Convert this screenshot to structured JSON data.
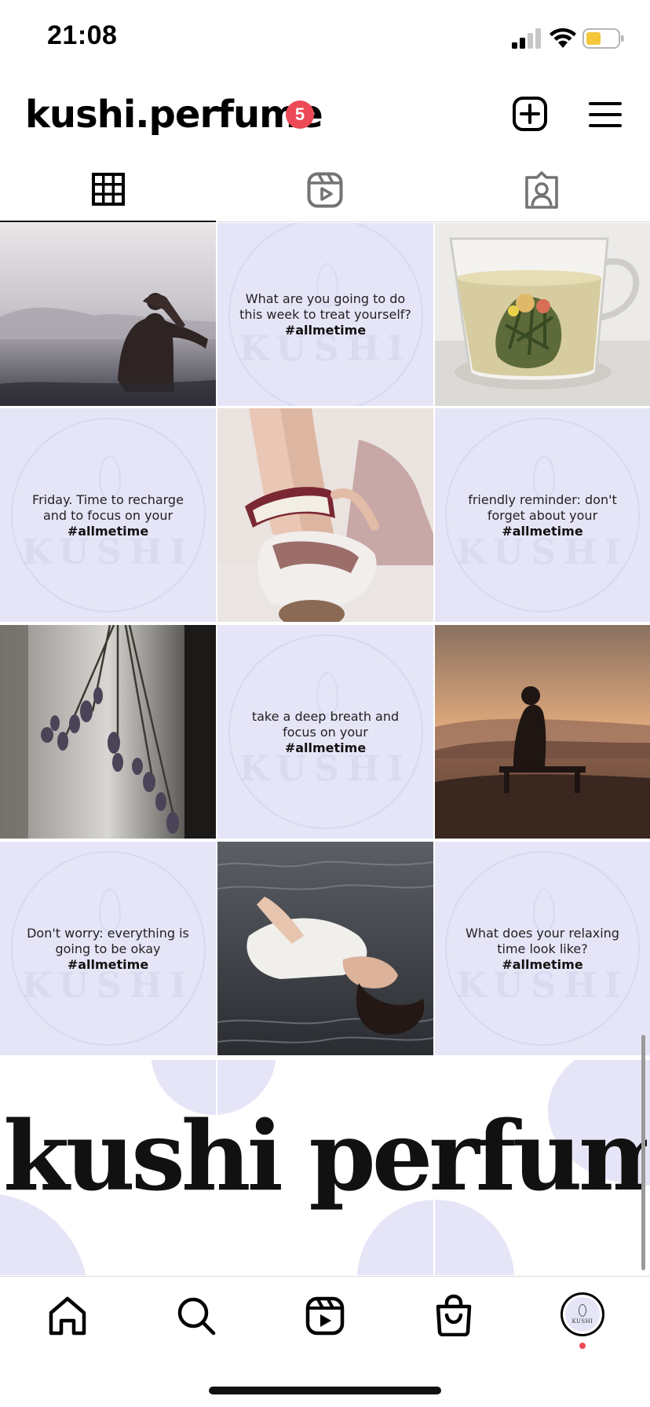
{
  "status_bar": {
    "time": "21:08"
  },
  "header": {
    "username": "kushi.perfume",
    "notification_count": "5",
    "badge_color": "#ed4956"
  },
  "tabs": [
    {
      "name": "posts-grid",
      "icon": "grid-icon",
      "active": true
    },
    {
      "name": "reels",
      "icon": "reels-icon",
      "active": false
    },
    {
      "name": "tagged",
      "icon": "tagged-icon",
      "active": false
    }
  ],
  "theme": {
    "lavender": "#e5e5f7",
    "lavender_circle": "#dadcf4"
  },
  "posts": [
    {
      "kind": "photo",
      "subject": "woman in lake"
    },
    {
      "kind": "quote",
      "text": "What are you going to do this week to treat yourself?",
      "hashtag": "#allmetime",
      "watermark": "KUSHI"
    },
    {
      "kind": "photo",
      "subject": "flowering tea in glass cup"
    },
    {
      "kind": "quote",
      "text": "Friday. Time to recharge and to focus on your",
      "hashtag": "#allmetime",
      "watermark": "KUSHI"
    },
    {
      "kind": "photo",
      "subject": "woman reading book on bed"
    },
    {
      "kind": "quote",
      "text": "friendly reminder: don't forget about your",
      "hashtag": "#allmetime",
      "watermark": "KUSHI"
    },
    {
      "kind": "photo",
      "subject": "hanging dried lavender"
    },
    {
      "kind": "quote",
      "text": "take a deep breath and focus on your",
      "hashtag": "#allmetime",
      "watermark": "KUSHI"
    },
    {
      "kind": "photo",
      "subject": "woman on bench at sunset"
    },
    {
      "kind": "quote",
      "text": "Don't worry: everything is going to be okay",
      "hashtag": "#allmetime",
      "watermark": "KUSHI"
    },
    {
      "kind": "photo",
      "subject": "woman lying in water"
    },
    {
      "kind": "quote",
      "text": "What does your relaxing time look like?",
      "hashtag": "#allmetime",
      "watermark": "KUSHI"
    }
  ],
  "banner": {
    "text": "kushi perfume"
  },
  "bottom_nav": [
    {
      "name": "home",
      "icon": "home-icon"
    },
    {
      "name": "search",
      "icon": "search-icon"
    },
    {
      "name": "reels",
      "icon": "reels-icon"
    },
    {
      "name": "shop",
      "icon": "shopping-bag-icon"
    },
    {
      "name": "profile",
      "icon": "avatar",
      "avatar_text": "KUSHI"
    }
  ]
}
